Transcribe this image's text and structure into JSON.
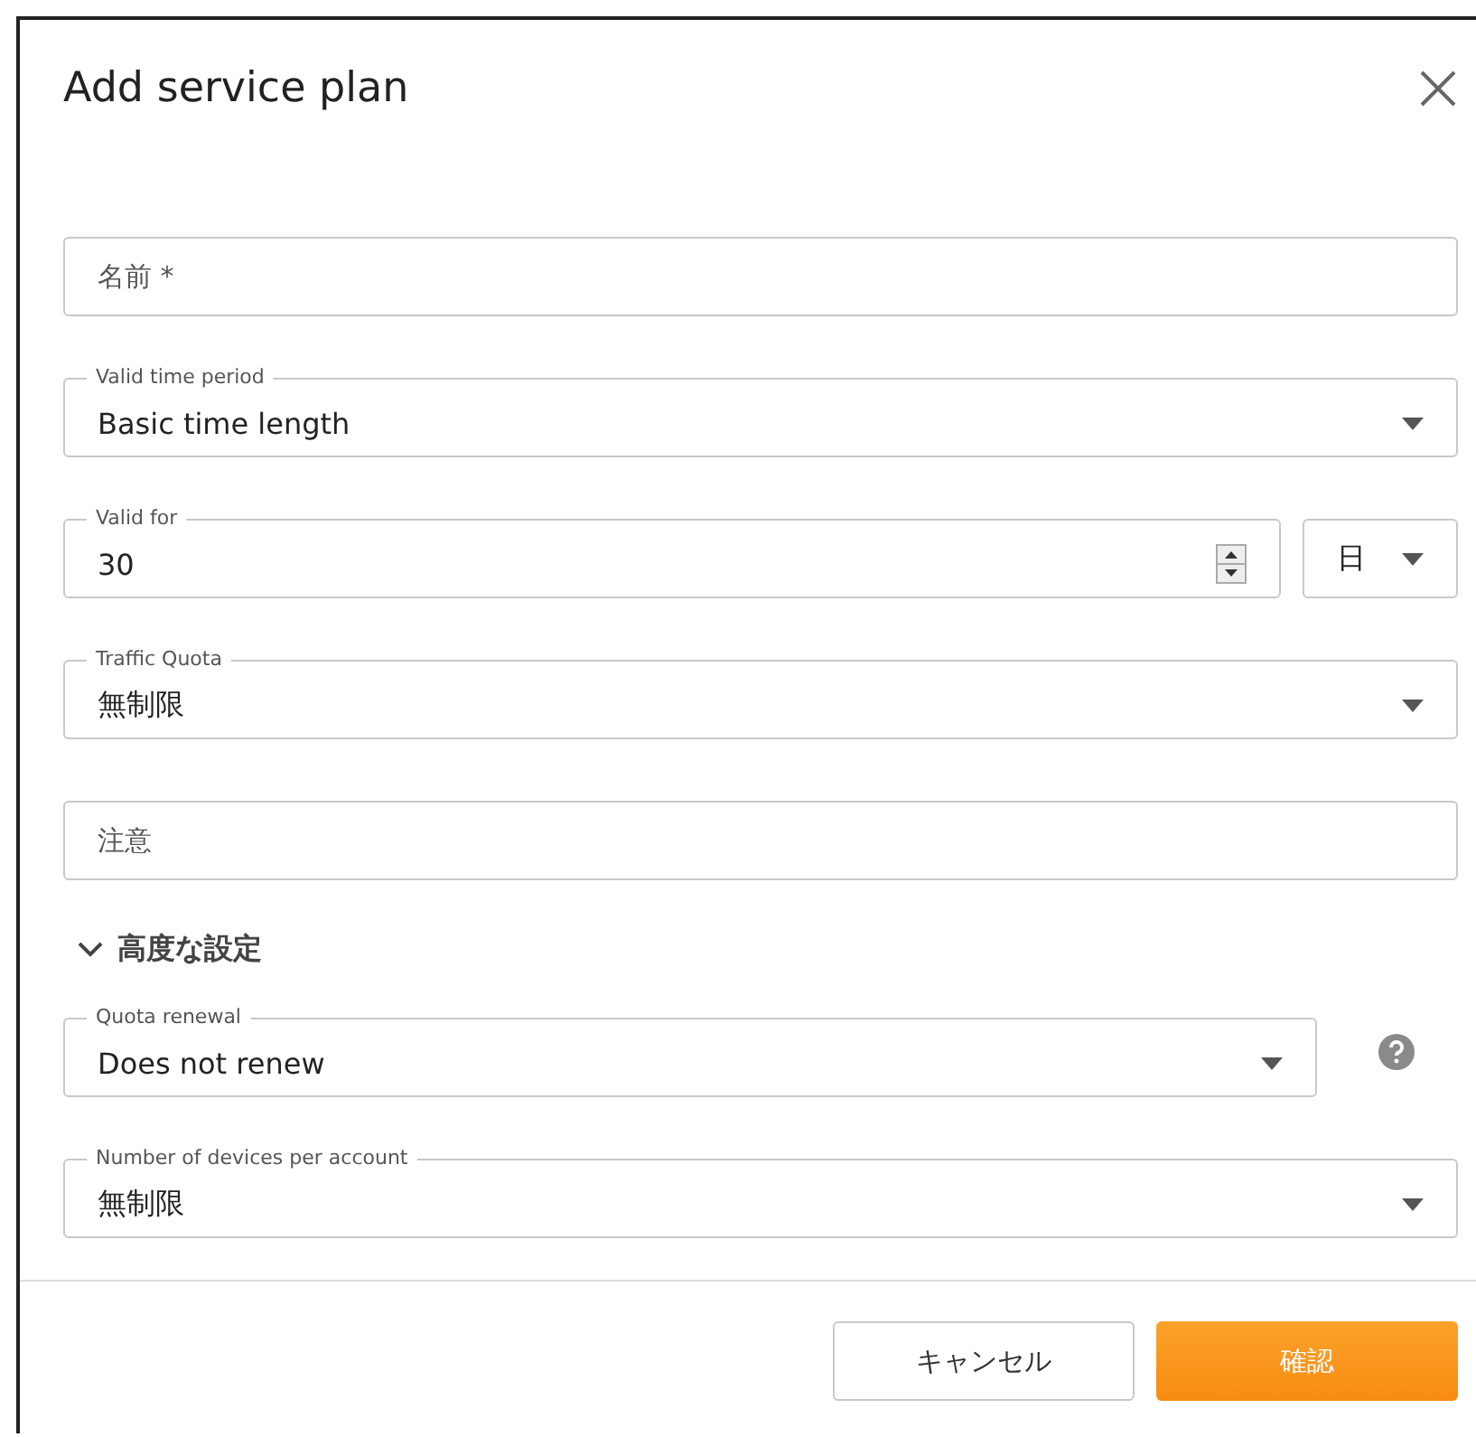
{
  "dialog": {
    "title": "Add service plan"
  },
  "fields": [
    {
      "kind": "text",
      "placeholder": "名前 *"
    },
    {
      "kind": "select",
      "label": "Valid time period",
      "value": "Basic time length"
    },
    {
      "kind": "number",
      "label": "Valid for",
      "value": "30",
      "unit": "日"
    },
    {
      "kind": "select",
      "label": "Traffic Quota",
      "value": "無制限"
    },
    {
      "kind": "text",
      "placeholder": "注意"
    }
  ],
  "advanced": {
    "title": "高度な設定",
    "expanded": true,
    "fields": [
      {
        "kind": "select_help",
        "label": "Quota renewal",
        "value": "Does not renew"
      },
      {
        "kind": "select",
        "label": "Number of devices per account",
        "value": "無制限"
      }
    ]
  },
  "buttons": [
    {
      "label": "キャンセル",
      "kind": "secondary"
    },
    {
      "label": "確認",
      "kind": "primary"
    }
  ]
}
